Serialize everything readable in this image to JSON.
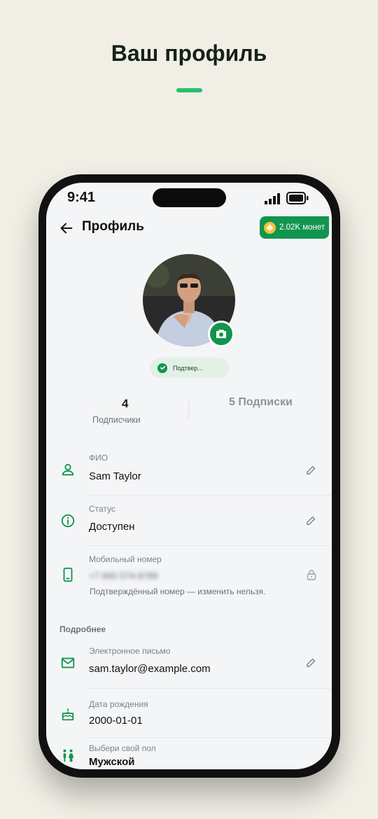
{
  "headline": "Ваш профиль",
  "status_bar": {
    "time": "9:41"
  },
  "header": {
    "title": "Профиль",
    "coins": "2.02K монет"
  },
  "verified_badge": "Подтвер...",
  "stats": {
    "followers_count": "4",
    "followers_label": "Подписчики",
    "following": "5 Подписки"
  },
  "fields": {
    "name": {
      "label": "ФИО",
      "value": "Sam Taylor"
    },
    "status": {
      "label": "Статус",
      "value": "Доступен"
    },
    "phone": {
      "label": "Мобильный номер",
      "value": "+7 900 574-9789",
      "hint": "Подтверждённый номер — изменить нельзя."
    },
    "section_title": "Подробнее",
    "email": {
      "label": "Электронное письмо",
      "value": "sam.taylor@example.com"
    },
    "birthday": {
      "label": "Дата рождения",
      "value": "2000-01-01"
    },
    "gender": {
      "label": "Выбери свой пол",
      "value": "Мужской"
    }
  },
  "colors": {
    "accent": "#12954e",
    "background": "#f1eee5",
    "screen": "#f4f5f7"
  }
}
